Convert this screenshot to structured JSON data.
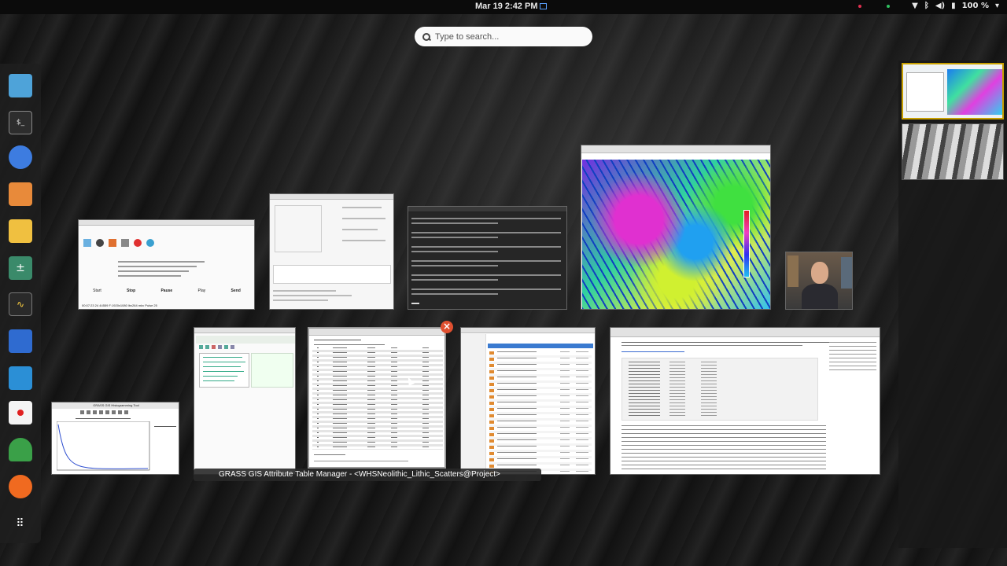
{
  "topbar": {
    "clock": "Mar 19  2:42 PM",
    "battery": "100 %"
  },
  "search": {
    "placeholder": "Type to search..."
  },
  "dock": {
    "items": [
      {
        "name": "files-icon",
        "color": "#4ea3d9"
      },
      {
        "name": "terminal-icon",
        "color": "#2d2d2d"
      },
      {
        "name": "browser-icon",
        "color": "#3d7ce0"
      },
      {
        "name": "app-store-icon",
        "color": "#e88a3a"
      },
      {
        "name": "text-editor-icon",
        "color": "#f0c040"
      },
      {
        "name": "calculator-icon",
        "color": "#3a8a6a"
      },
      {
        "name": "system-monitor-icon",
        "color": "#2a2a2a"
      },
      {
        "name": "software-updater-icon",
        "color": "#2f6bd0"
      },
      {
        "name": "screenshot-icon",
        "color": "#2b8fd6"
      },
      {
        "name": "recorder-icon",
        "color": "#e02020"
      },
      {
        "name": "grass-gis-icon",
        "color": "#3aa048"
      },
      {
        "name": "firefox-icon",
        "color": "#f06a20"
      },
      {
        "name": "app-grid-icon",
        "color": "#ffffff"
      }
    ]
  },
  "recorder": {
    "buttons": [
      "Stop",
      "Pause",
      "Send"
    ],
    "status": "00:07:23    24    44559    F:1920x1080    lbx264    mkv    Pulse    25"
  },
  "plot_window": {
    "title": "GRASS GIS Histogramming Tool"
  },
  "caption": "GRASS GIS Attribute Table Manager - <WHSNeolithic_Lithic_Scatters@Project>"
}
